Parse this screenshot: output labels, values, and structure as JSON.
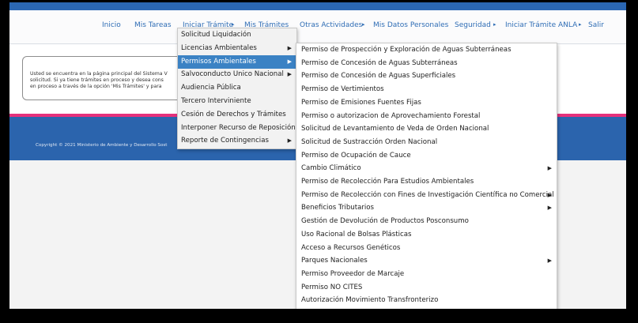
{
  "nav": {
    "items": [
      "Inicio",
      "Mis Tareas",
      "Iniciar Trámite",
      "Mis Trámites",
      "Otras Actividades",
      "Mis Datos Personales",
      "Seguridad",
      "Iniciar Trámite ANLA",
      "Salir"
    ],
    "arrow_glyph": "▸"
  },
  "intro": {
    "lines": [
      "Usted se encuentra en la página principal del Sistema V",
      "solicitud. Si ya tiene trámites en proceso y desea cons",
      "en proceso a través de la opción 'Mis Trámites' y para"
    ]
  },
  "footer": {
    "copyright": "Copyright © 2021 Ministerio de Ambiente y Desarrollo Sost"
  },
  "submenu_iniciar": [
    {
      "label": "Solicitud Liquidación",
      "has_sub": false,
      "active": false
    },
    {
      "label": "Licencias Ambientales",
      "has_sub": true,
      "active": false
    },
    {
      "label": "Permisos Ambientales",
      "has_sub": true,
      "active": true
    },
    {
      "label": "Salvoconducto Unico Nacional",
      "has_sub": true,
      "active": false
    },
    {
      "label": "Audiencia Pública",
      "has_sub": false,
      "active": false
    },
    {
      "label": "Tercero Interviniente",
      "has_sub": false,
      "active": false
    },
    {
      "label": "Cesión de Derechos y Trámites",
      "has_sub": false,
      "active": false
    },
    {
      "label": "Interponer Recurso de Reposición",
      "has_sub": false,
      "active": false
    },
    {
      "label": "Reporte de Contingencias",
      "has_sub": true,
      "active": false
    }
  ],
  "submenu_permisos": [
    {
      "label": "Permiso de Prospección y Exploración de Aguas Subterráneas",
      "has_sub": false
    },
    {
      "label": "Permiso de Concesión de Aguas Subterráneas",
      "has_sub": false
    },
    {
      "label": "Permiso de Concesión de Aguas Superficiales",
      "has_sub": false
    },
    {
      "label": "Permiso de Vertimientos",
      "has_sub": false
    },
    {
      "label": "Permiso de Emisiones Fuentes Fijas",
      "has_sub": false
    },
    {
      "label": "Permiso o autorizacion de Aprovechamiento Forestal",
      "has_sub": false
    },
    {
      "label": "Solicitud de Levantamiento de Veda de Orden Nacional",
      "has_sub": false
    },
    {
      "label": "Solicitud de Sustracción Orden Nacional",
      "has_sub": false
    },
    {
      "label": "Permiso de Ocupación de Cauce",
      "has_sub": false
    },
    {
      "label": "Cambio Climático",
      "has_sub": true
    },
    {
      "label": "Permiso de Recolección Para Estudios Ambientales",
      "has_sub": false
    },
    {
      "label": "Permiso de Recolección con Fines de Investigación Científica no Comercial",
      "has_sub": true
    },
    {
      "label": "Beneficios Tributarios",
      "has_sub": true
    },
    {
      "label": "Gestión de Devolución de Productos Posconsumo",
      "has_sub": false
    },
    {
      "label": "Uso Racional de Bolsas Plásticas",
      "has_sub": false
    },
    {
      "label": "Acceso a Recursos Genéticos",
      "has_sub": false
    },
    {
      "label": "Parques Nacionales",
      "has_sub": true
    },
    {
      "label": "Permiso Proveedor de Marcaje",
      "has_sub": false
    },
    {
      "label": "Permiso NO CITES",
      "has_sub": false
    },
    {
      "label": "Autorización Movimiento Transfronterizo",
      "has_sub": false
    }
  ],
  "colors": {
    "brand_blue": "#2b64ad",
    "accent_pink": "#e5317b",
    "link": "#2f6db5",
    "active": "#3b82c4"
  }
}
